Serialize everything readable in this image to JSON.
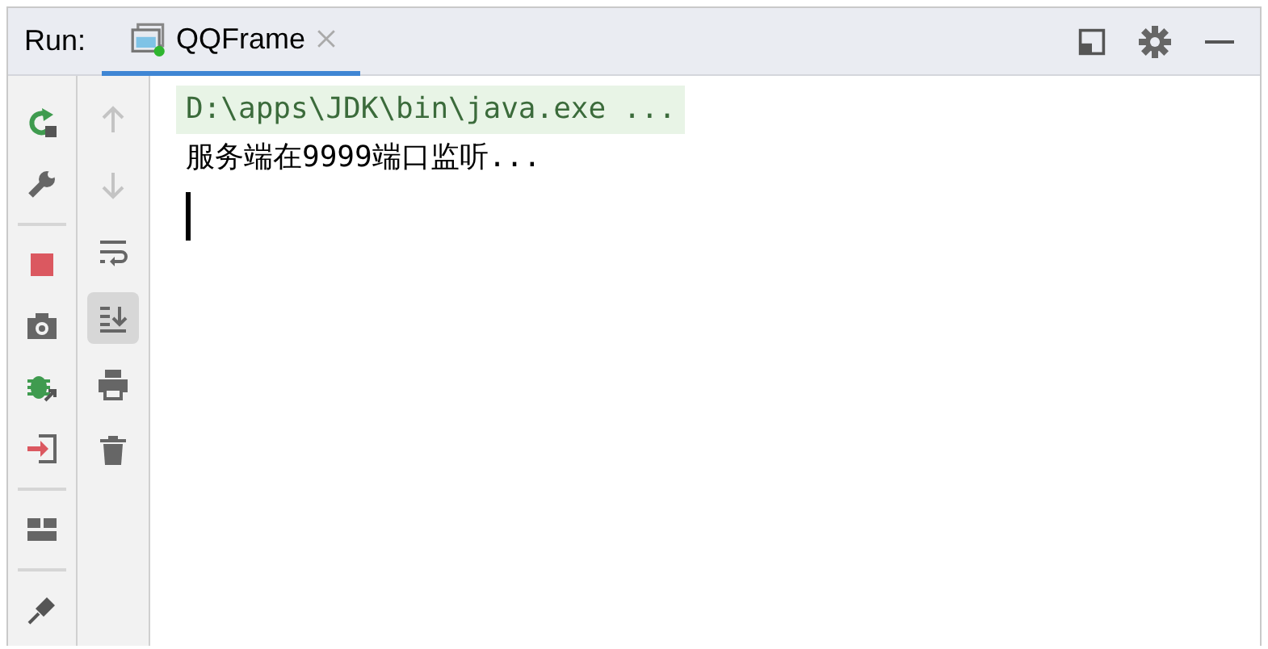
{
  "header": {
    "label": "Run:",
    "tabs": [
      {
        "label": "QQFrame",
        "selected": true
      }
    ]
  },
  "run_toolbar": [
    {
      "kind": "rerun"
    },
    {
      "kind": "settings"
    },
    {
      "kind": "separator"
    },
    {
      "kind": "stop"
    },
    {
      "kind": "camera"
    },
    {
      "kind": "debug"
    },
    {
      "kind": "exit"
    },
    {
      "kind": "separator"
    },
    {
      "kind": "layout"
    },
    {
      "kind": "separator"
    },
    {
      "kind": "pin"
    }
  ],
  "console_toolbar": [
    {
      "kind": "up",
      "disabled": true,
      "selected": false
    },
    {
      "kind": "down",
      "disabled": true,
      "selected": false
    },
    {
      "kind": "wrap",
      "disabled": false,
      "selected": false
    },
    {
      "kind": "scroll",
      "disabled": false,
      "selected": true
    },
    {
      "kind": "print",
      "disabled": false,
      "selected": false
    },
    {
      "kind": "trash",
      "disabled": false,
      "selected": false
    }
  ],
  "console": {
    "lines": [
      {
        "kind": "command",
        "text": "D:\\apps\\JDK\\bin\\java.exe ..."
      },
      {
        "kind": "output",
        "text": "服务端在9999端口监听..."
      }
    ],
    "caret": true
  }
}
